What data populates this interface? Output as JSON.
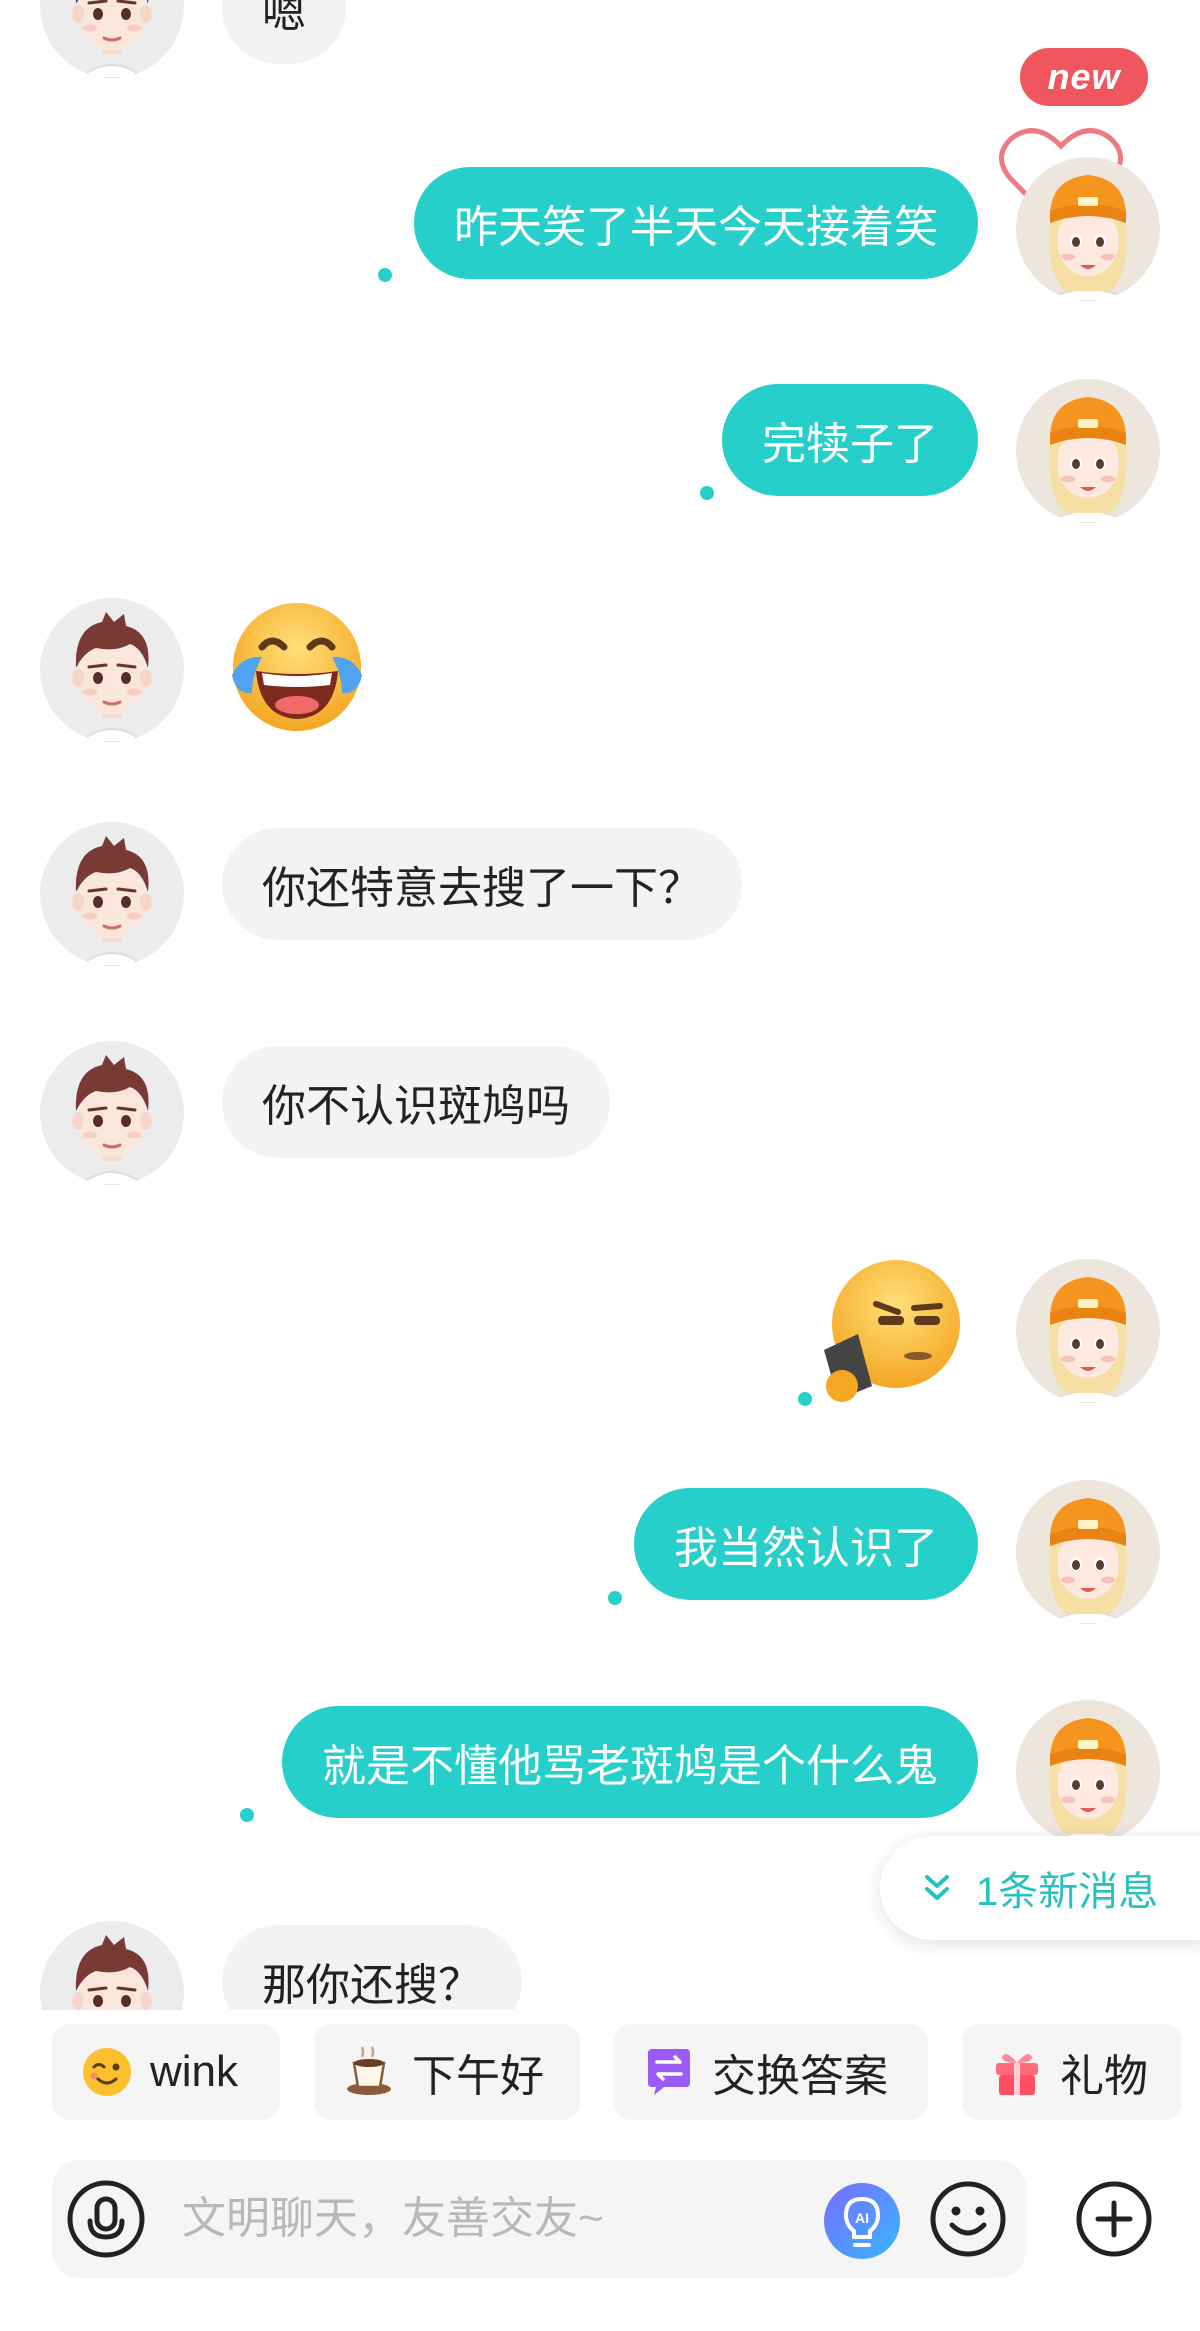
{
  "badge": {
    "new": "new"
  },
  "messages": [
    {
      "id": "m0",
      "side": "in",
      "text": "嗯"
    },
    {
      "id": "m1",
      "side": "out",
      "text": "昨天笑了半天今天接着笑"
    },
    {
      "id": "m2",
      "side": "out",
      "text": "完犊子了"
    },
    {
      "id": "m3",
      "side": "in",
      "emoji": "tears-of-joy-emoji"
    },
    {
      "id": "m4",
      "side": "in",
      "text": "你还特意去搜了一下？"
    },
    {
      "id": "m5",
      "side": "in",
      "text": "你不认识斑鸠吗"
    },
    {
      "id": "m6",
      "side": "out",
      "emoji": "side-eye-phone-emoji"
    },
    {
      "id": "m7",
      "side": "out",
      "text": "我当然认识了"
    },
    {
      "id": "m8",
      "side": "out",
      "text": "就是不懂他骂老斑鸠是个什么鬼"
    },
    {
      "id": "m9",
      "side": "in",
      "text": "那你还搜？"
    }
  ],
  "new_messages": {
    "label": "1条新消息",
    "icon": "chevron-double-down-icon"
  },
  "quick_actions": [
    {
      "label": "wink",
      "icon": "wink-emoji-icon"
    },
    {
      "label": "下午好",
      "icon": "coffee-cup-icon"
    },
    {
      "label": "交换答案",
      "icon": "exchange-icon"
    },
    {
      "label": "礼物",
      "icon": "gift-icon"
    }
  ],
  "composer": {
    "placeholder": "文明聊天，友善交友~",
    "voice_icon": "voice-icon",
    "ai_icon": "ai-bulb-icon",
    "emoji_icon": "smiley-icon",
    "add_icon": "plus-circle-icon"
  },
  "colors": {
    "accent": "#27cfcb",
    "incoming_bubble": "#f3f3f3",
    "badge": "#f0565d",
    "new_message_text": "#27c2bf"
  }
}
